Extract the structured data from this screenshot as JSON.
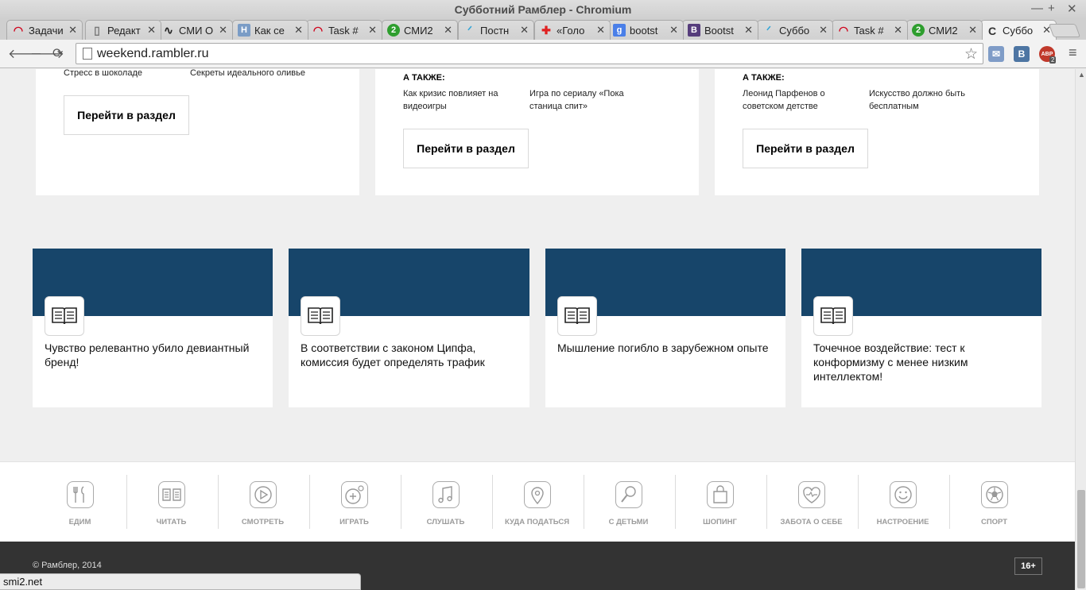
{
  "window": {
    "title": "Субботний Рамблер - Chromium",
    "controls": [
      "—",
      "+",
      "✕"
    ]
  },
  "tabs": [
    {
      "label": "Задачи",
      "favicon": "rambler-icon",
      "color": "#d0021b",
      "glyph": "◠"
    },
    {
      "label": "Редакт",
      "favicon": "page-icon",
      "color": "#777777",
      "glyph": "▯"
    },
    {
      "label": "СМИ О",
      "favicon": "chart-icon",
      "color": "#222222",
      "glyph": "∿"
    },
    {
      "label": "Как се",
      "favicon": "h-icon",
      "color": "#7a9cc6",
      "glyph": "H"
    },
    {
      "label": "Task #",
      "favicon": "rambler-icon",
      "color": "#d0021b",
      "glyph": "◠"
    },
    {
      "label": "СМИ2",
      "favicon": "smi2-icon",
      "color": "#2e9e2e",
      "glyph": "2"
    },
    {
      "label": "Постн",
      "favicon": "bird-icon",
      "color": "#33a6d8",
      "glyph": "ᐟ"
    },
    {
      "label": "«Голо",
      "favicon": "red-cross-icon",
      "color": "#e02020",
      "glyph": "✚"
    },
    {
      "label": "bootst",
      "favicon": "google-icon",
      "color": "#4a7fe8",
      "glyph": "g"
    },
    {
      "label": "Bootst",
      "favicon": "bootstrap-icon",
      "color": "#563d7c",
      "glyph": "B"
    },
    {
      "label": "Суббо",
      "favicon": "bird-icon",
      "color": "#33a6d8",
      "glyph": "ᐟ"
    },
    {
      "label": "Task #",
      "favicon": "rambler-icon",
      "color": "#d0021b",
      "glyph": "◠"
    },
    {
      "label": "СМИ2",
      "favicon": "smi2-icon",
      "color": "#2e9e2e",
      "glyph": "2"
    },
    {
      "label": "Суббо",
      "favicon": "loading-icon",
      "color": "#333333",
      "glyph": "C",
      "active": true
    }
  ],
  "toolbar": {
    "back": "🡐",
    "forward": "🡒",
    "reload": "⟳",
    "url": "weekend.rambler.ru",
    "star": "☆",
    "menu": "≡",
    "abp_badge": "ABP",
    "abp_count": "2",
    "vk": "В"
  },
  "sections": [
    {
      "items": [
        "Стресс в шоколаде",
        "Секреты идеального оливье"
      ],
      "button": "Перейти в раздел"
    },
    {
      "also_title": "А ТАКЖЕ:",
      "items": [
        "Как кризис повлияет на видеоигры",
        "Игра по сериалу «Пока станица спит»"
      ],
      "button": "Перейти в раздел"
    },
    {
      "also_title": "А ТАКЖЕ:",
      "items": [
        "Леонид Парфенов о советском детстве",
        "Искусство должно быть бесплатным"
      ],
      "button": "Перейти в раздел"
    }
  ],
  "tiles": [
    {
      "text": "Чувство релевантно убило девиантный бренд!"
    },
    {
      "text": "В соответствии с законом Ципфа, комиссия будет определять трафик"
    },
    {
      "text": "Мышление погибло в зарубежном опыте"
    },
    {
      "text": "Точечное воздействие: тест к конформизму с менее низким интеллектом!"
    }
  ],
  "categories": [
    {
      "label": "ЕДИМ",
      "icon": "fork-knife-icon"
    },
    {
      "label": "ЧИТАТЬ",
      "icon": "book-icon"
    },
    {
      "label": "СМОТРЕТЬ",
      "icon": "play-icon"
    },
    {
      "label": "ИГРАТЬ",
      "icon": "gamepad-icon"
    },
    {
      "label": "СЛУШАТЬ",
      "icon": "music-icon"
    },
    {
      "label": "КУДА ПОДАТЬСЯ",
      "icon": "location-pin-icon"
    },
    {
      "label": "С ДЕТЬМИ",
      "icon": "rattle-icon"
    },
    {
      "label": "ШОПИНГ",
      "icon": "shopping-bag-icon"
    },
    {
      "label": "ЗАБОТА О СЕБЕ",
      "icon": "heart-pulse-icon"
    },
    {
      "label": "НАСТРОЕНИЕ",
      "icon": "smile-icon"
    },
    {
      "label": "СПОРТ",
      "icon": "soccer-ball-icon"
    }
  ],
  "footer": {
    "copyright": "© Рамблер, 2014",
    "age": "16+"
  },
  "status": {
    "text": "smi2.net"
  },
  "colors": {
    "tile_band": "#17456a",
    "footer_bg": "#333333",
    "category_icon": "#aaaaaa"
  }
}
